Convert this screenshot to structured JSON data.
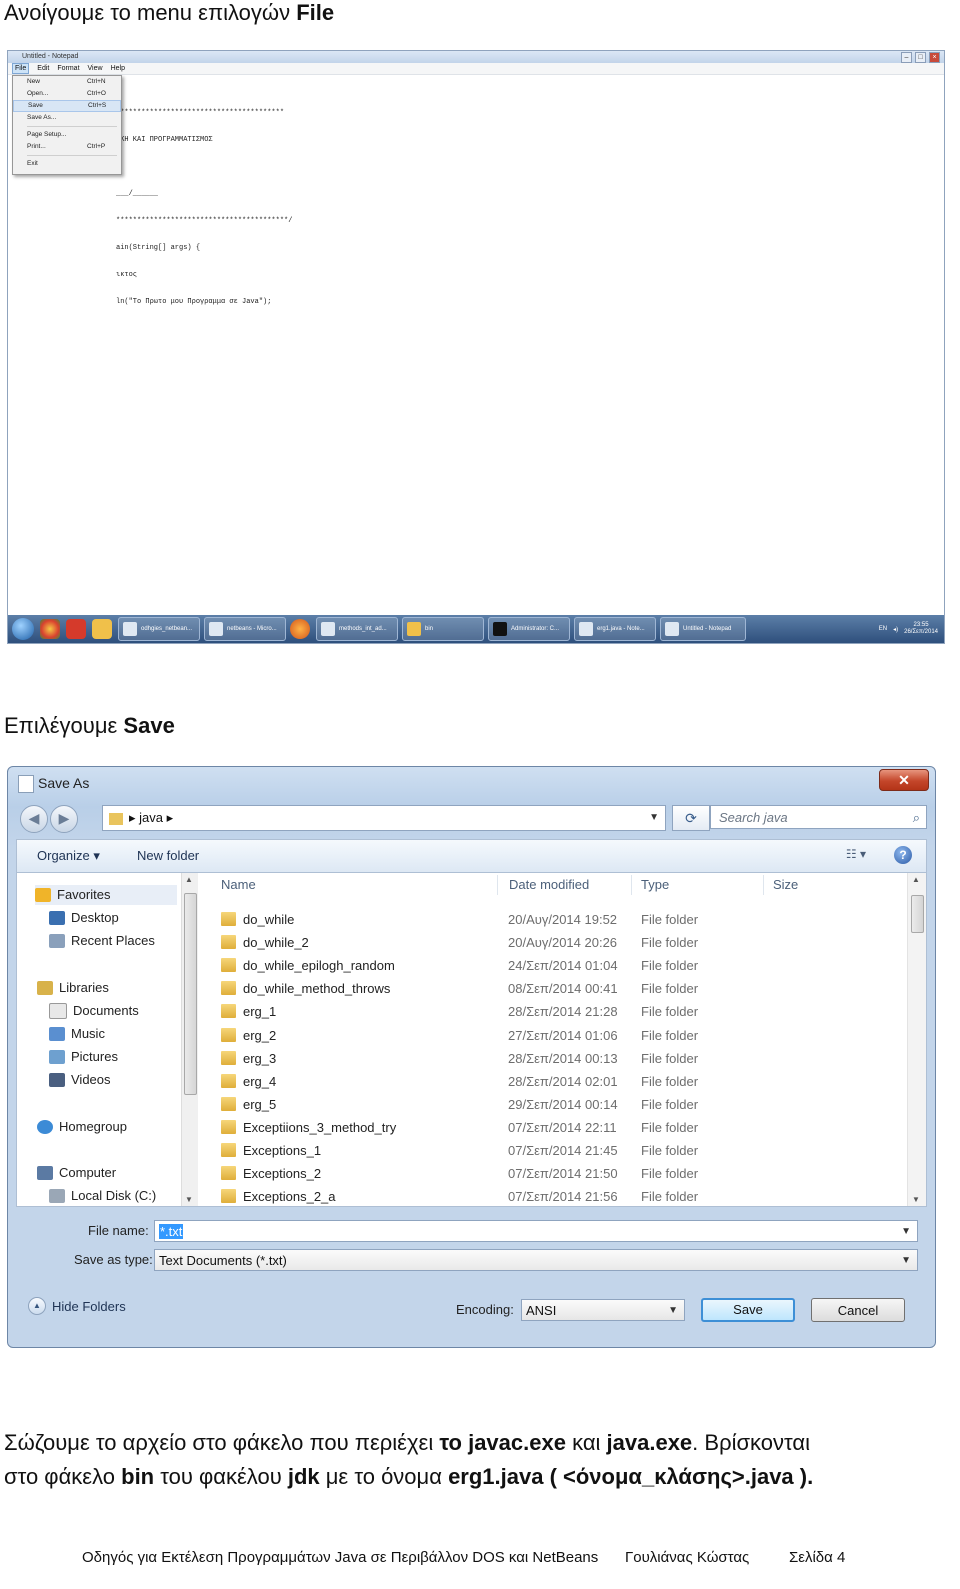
{
  "heading1": {
    "text": "Ανοίγουμε το menu επιλογών ",
    "bold": "File"
  },
  "notepad": {
    "title": "Untitled - Notepad",
    "menu": [
      "File",
      "Edit",
      "Format",
      "View",
      "Help"
    ],
    "file_menu": [
      {
        "label": "New",
        "shortcut": "Ctrl+N"
      },
      {
        "label": "Open...",
        "shortcut": "Ctrl+O"
      },
      {
        "label": "Save",
        "shortcut": "Ctrl+S"
      },
      {
        "label": "Save As...",
        "shortcut": ""
      },
      {
        "label": "Page Setup...",
        "shortcut": ""
      },
      {
        "label": "Print...",
        "shortcut": "Ctrl+P"
      },
      {
        "label": "Exit",
        "shortcut": ""
      }
    ],
    "code_lines": [
      "****************************************",
      "ΙΚΗ ΚΑΙ ΠΡΟΓΡΑΜΜΑΤΙΣΜΟΣ",
      "",
      "___/______",
      "*****************************************/",
      "ain(String[] args) {",
      "ικτος",
      "ln(\"Το Πρωτο μου Προγραμμα σε Java\");"
    ],
    "taskbar_items": [
      "odhgies_netbean...",
      "netbeans - Micro...",
      "methods_int_ad...",
      "bin",
      "Administrator: C...",
      "erg1.java - Note...",
      "Untitled - Notepad"
    ],
    "tray_lang": "EN",
    "clock_time": "23:55",
    "clock_date": "26/Σεπ/2014"
  },
  "heading2": {
    "text": "Επιλέγουμε ",
    "bold": "Save"
  },
  "dialog": {
    "title": "Save As",
    "address": "java",
    "search_placeholder": "Search java",
    "organize": "Organize ▾",
    "new_folder": "New folder",
    "nav": [
      {
        "label": "Favorites",
        "color": "#f0b429"
      },
      {
        "label": "Desktop",
        "color": "#3a6fb0"
      },
      {
        "label": "Recent Places",
        "color": "#8aa0bb"
      },
      {
        "label": "Libraries",
        "color": "#d8b24a"
      },
      {
        "label": "Documents",
        "color": "#e8e8e8"
      },
      {
        "label": "Music",
        "color": "#5a8fd0"
      },
      {
        "label": "Pictures",
        "color": "#6ea0cf"
      },
      {
        "label": "Videos",
        "color": "#4a5f80"
      },
      {
        "label": "Homegroup",
        "color": "#3c8bd6"
      },
      {
        "label": "Computer",
        "color": "#5b7aa3"
      },
      {
        "label": "Local Disk (C:)",
        "color": "#9aa7b6"
      }
    ],
    "columns": [
      "Name",
      "Date modified",
      "Type",
      "Size"
    ],
    "files": [
      {
        "name": "do_while",
        "date": "20/Αυγ/2014 19:52",
        "type": "File folder"
      },
      {
        "name": "do_while_2",
        "date": "20/Αυγ/2014 20:26",
        "type": "File folder"
      },
      {
        "name": "do_while_epilogh_random",
        "date": "24/Σεπ/2014 01:04",
        "type": "File folder"
      },
      {
        "name": "do_while_method_throws",
        "date": "08/Σεπ/2014 00:41",
        "type": "File folder"
      },
      {
        "name": "erg_1",
        "date": "28/Σεπ/2014 21:28",
        "type": "File folder"
      },
      {
        "name": "erg_2",
        "date": "27/Σεπ/2014 01:06",
        "type": "File folder"
      },
      {
        "name": "erg_3",
        "date": "28/Σεπ/2014 00:13",
        "type": "File folder"
      },
      {
        "name": "erg_4",
        "date": "28/Σεπ/2014 02:01",
        "type": "File folder"
      },
      {
        "name": "erg_5",
        "date": "29/Σεπ/2014 00:14",
        "type": "File folder"
      },
      {
        "name": "Exceptiions_3_method_try",
        "date": "07/Σεπ/2014 22:11",
        "type": "File folder"
      },
      {
        "name": "Exceptions_1",
        "date": "07/Σεπ/2014 21:45",
        "type": "File folder"
      },
      {
        "name": "Exceptions_2",
        "date": "07/Σεπ/2014 21:50",
        "type": "File folder"
      },
      {
        "name": "Exceptions_2_a",
        "date": "07/Σεπ/2014 21:56",
        "type": "File folder"
      }
    ],
    "file_name_label": "File name:",
    "file_name_value": "*.txt",
    "save_type_label": "Save as type:",
    "save_type_value": "Text Documents (*.txt)",
    "hide_folders": "Hide Folders",
    "encoding_label": "Encoding:",
    "encoding_value": "ANSI",
    "save_button": "Save",
    "cancel_button": "Cancel"
  },
  "paragraph": {
    "l1_a": "Σώζουμε το αρχείο στο φάκελο που περιέχει ",
    "l1_b": "το javac.exe",
    "l1_c": " και ",
    "l1_d": "java.exe",
    "l1_e": ". Βρίσκονται",
    "l2_a": "στο φάκελο ",
    "l2_b": "bin",
    "l2_c": " του φακέλου ",
    "l2_d": "jdk",
    "l2_e": " με το όνομα ",
    "l2_f": "erg1.java ( <όνομα_κλάσης>.java )."
  },
  "footer": {
    "guide": "Οδηγός για Εκτέλεση Προγραμμάτων Java σε Περιβάλλον DOS και NetBeans",
    "author": "Γουλιάνας Κώστας",
    "page": "Σελίδα 4"
  }
}
